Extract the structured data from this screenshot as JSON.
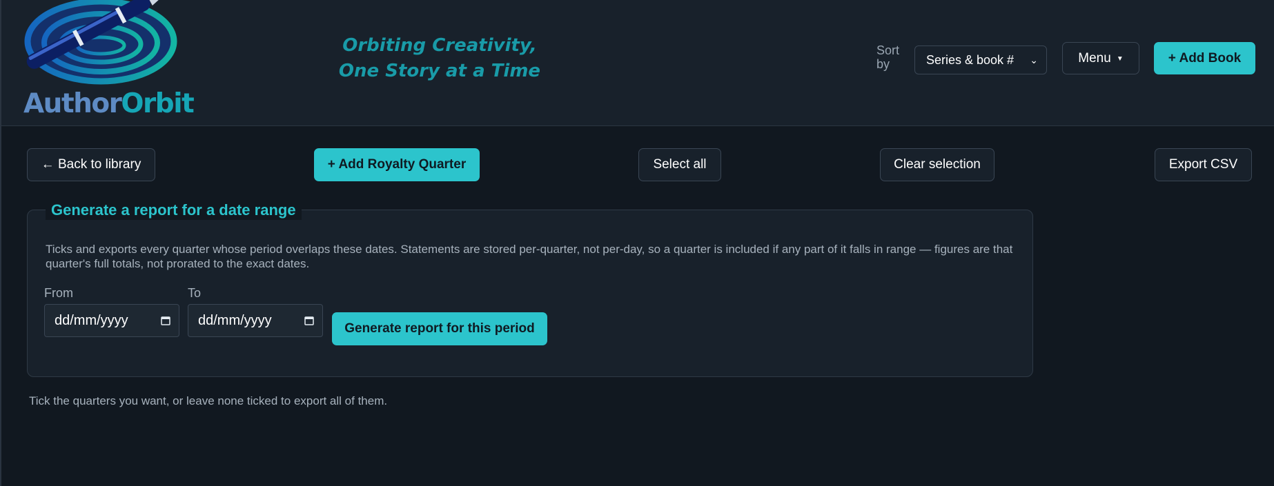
{
  "header": {
    "brand": {
      "part1": "Author",
      "part2": "Orbit"
    },
    "tagline": {
      "line1": "Orbiting Creativity,",
      "line2": "One Story at a Time"
    },
    "sort": {
      "label": "Sort by",
      "selected": "Series & book #"
    },
    "menu_label": "Menu",
    "add_book_label": "+ Add Book"
  },
  "toolbar": {
    "back_label": "← Back to library",
    "add_royalty_label": "+ Add Royalty Quarter",
    "select_all_label": "Select all",
    "clear_selection_label": "Clear selection",
    "export_csv_label": "Export CSV"
  },
  "report": {
    "title": "Generate a report for a date range",
    "help": "Ticks and exports every quarter whose period overlaps these dates. Statements are stored per-quarter, not per-day, so a quarter is included if any part of it falls in range — figures are that quarter's full totals, not prorated to the exact dates.",
    "from_label": "From",
    "to_label": "To",
    "from_value": "dd/mm/yyyy",
    "to_value": "dd/mm/yyyy",
    "generate_label": "Generate report for this period"
  },
  "footnote": "Tick the quarters you want, or leave none ticked to export all of them.",
  "colors": {
    "accent": "#2cc4cc",
    "background": "#111820",
    "header": "#18212b"
  },
  "icons": [
    "pen-orbit-logo-icon",
    "chevron-down-icon",
    "caret-down-icon",
    "calendar-icon"
  ]
}
